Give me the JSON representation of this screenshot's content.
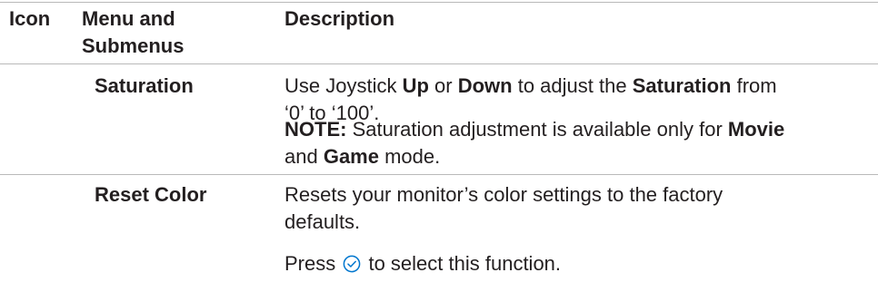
{
  "header": {
    "icon": "Icon",
    "menu_line1": "Menu and",
    "menu_line2": "Submenus",
    "description": "Description"
  },
  "rows": [
    {
      "submenu": "Saturation",
      "desc1": {
        "t1": "Use Joystick ",
        "b1": "Up",
        "t2": " or ",
        "b2": "Down",
        "t3": " to adjust the ",
        "b3": "Saturation",
        "t4": " from",
        "line2": "‘0’ to ‘100’."
      },
      "note": {
        "label": "NOTE:",
        "t1": " Saturation adjustment is available only for ",
        "b1": "Movie",
        "t2": "and ",
        "b2": "Game",
        "t3": " mode."
      }
    },
    {
      "submenu": "Reset Color",
      "desc1": {
        "line1": "Resets your monitor’s color settings to the factory",
        "line2": "defaults."
      },
      "press": {
        "before": "Press ",
        "icon": "check-circle-icon",
        "after": " to select this function."
      }
    }
  ],
  "colors": {
    "text": "#231f20",
    "rule": "#b9b9b9",
    "icon": "#0076ce"
  }
}
